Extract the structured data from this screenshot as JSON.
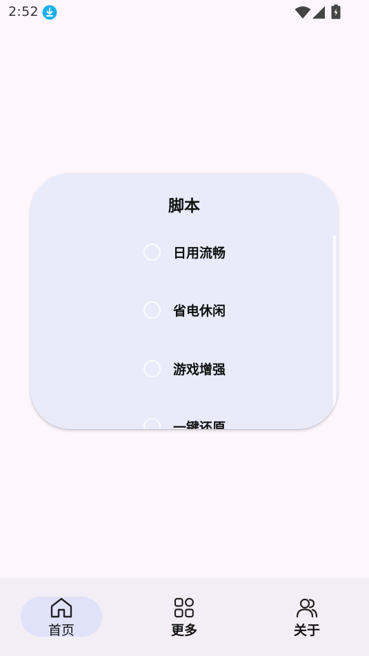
{
  "status_bar": {
    "time": "2:52",
    "download_icon": "download-icon",
    "wifi_icon": "wifi-icon",
    "signal_icon": "cell-signal-icon",
    "battery_icon": "battery-charging-icon"
  },
  "card": {
    "title": "脚本",
    "options": [
      {
        "label": "日用流畅",
        "selected": false
      },
      {
        "label": "省电休闲",
        "selected": false
      },
      {
        "label": "游戏增强",
        "selected": false
      },
      {
        "label": "一键还原",
        "selected": false
      }
    ]
  },
  "bottom_nav": {
    "items": [
      {
        "label": "首页",
        "icon": "home-icon",
        "active": true
      },
      {
        "label": "更多",
        "icon": "grid-icon",
        "active": false
      },
      {
        "label": "关于",
        "icon": "users-icon",
        "active": false
      }
    ]
  },
  "colors": {
    "background": "#fdf7fd",
    "card": "#e9ebfb",
    "nav_background": "#f3eef5",
    "nav_active_pill": "#e0e2fa",
    "download_badge": "#1ab0f0"
  }
}
